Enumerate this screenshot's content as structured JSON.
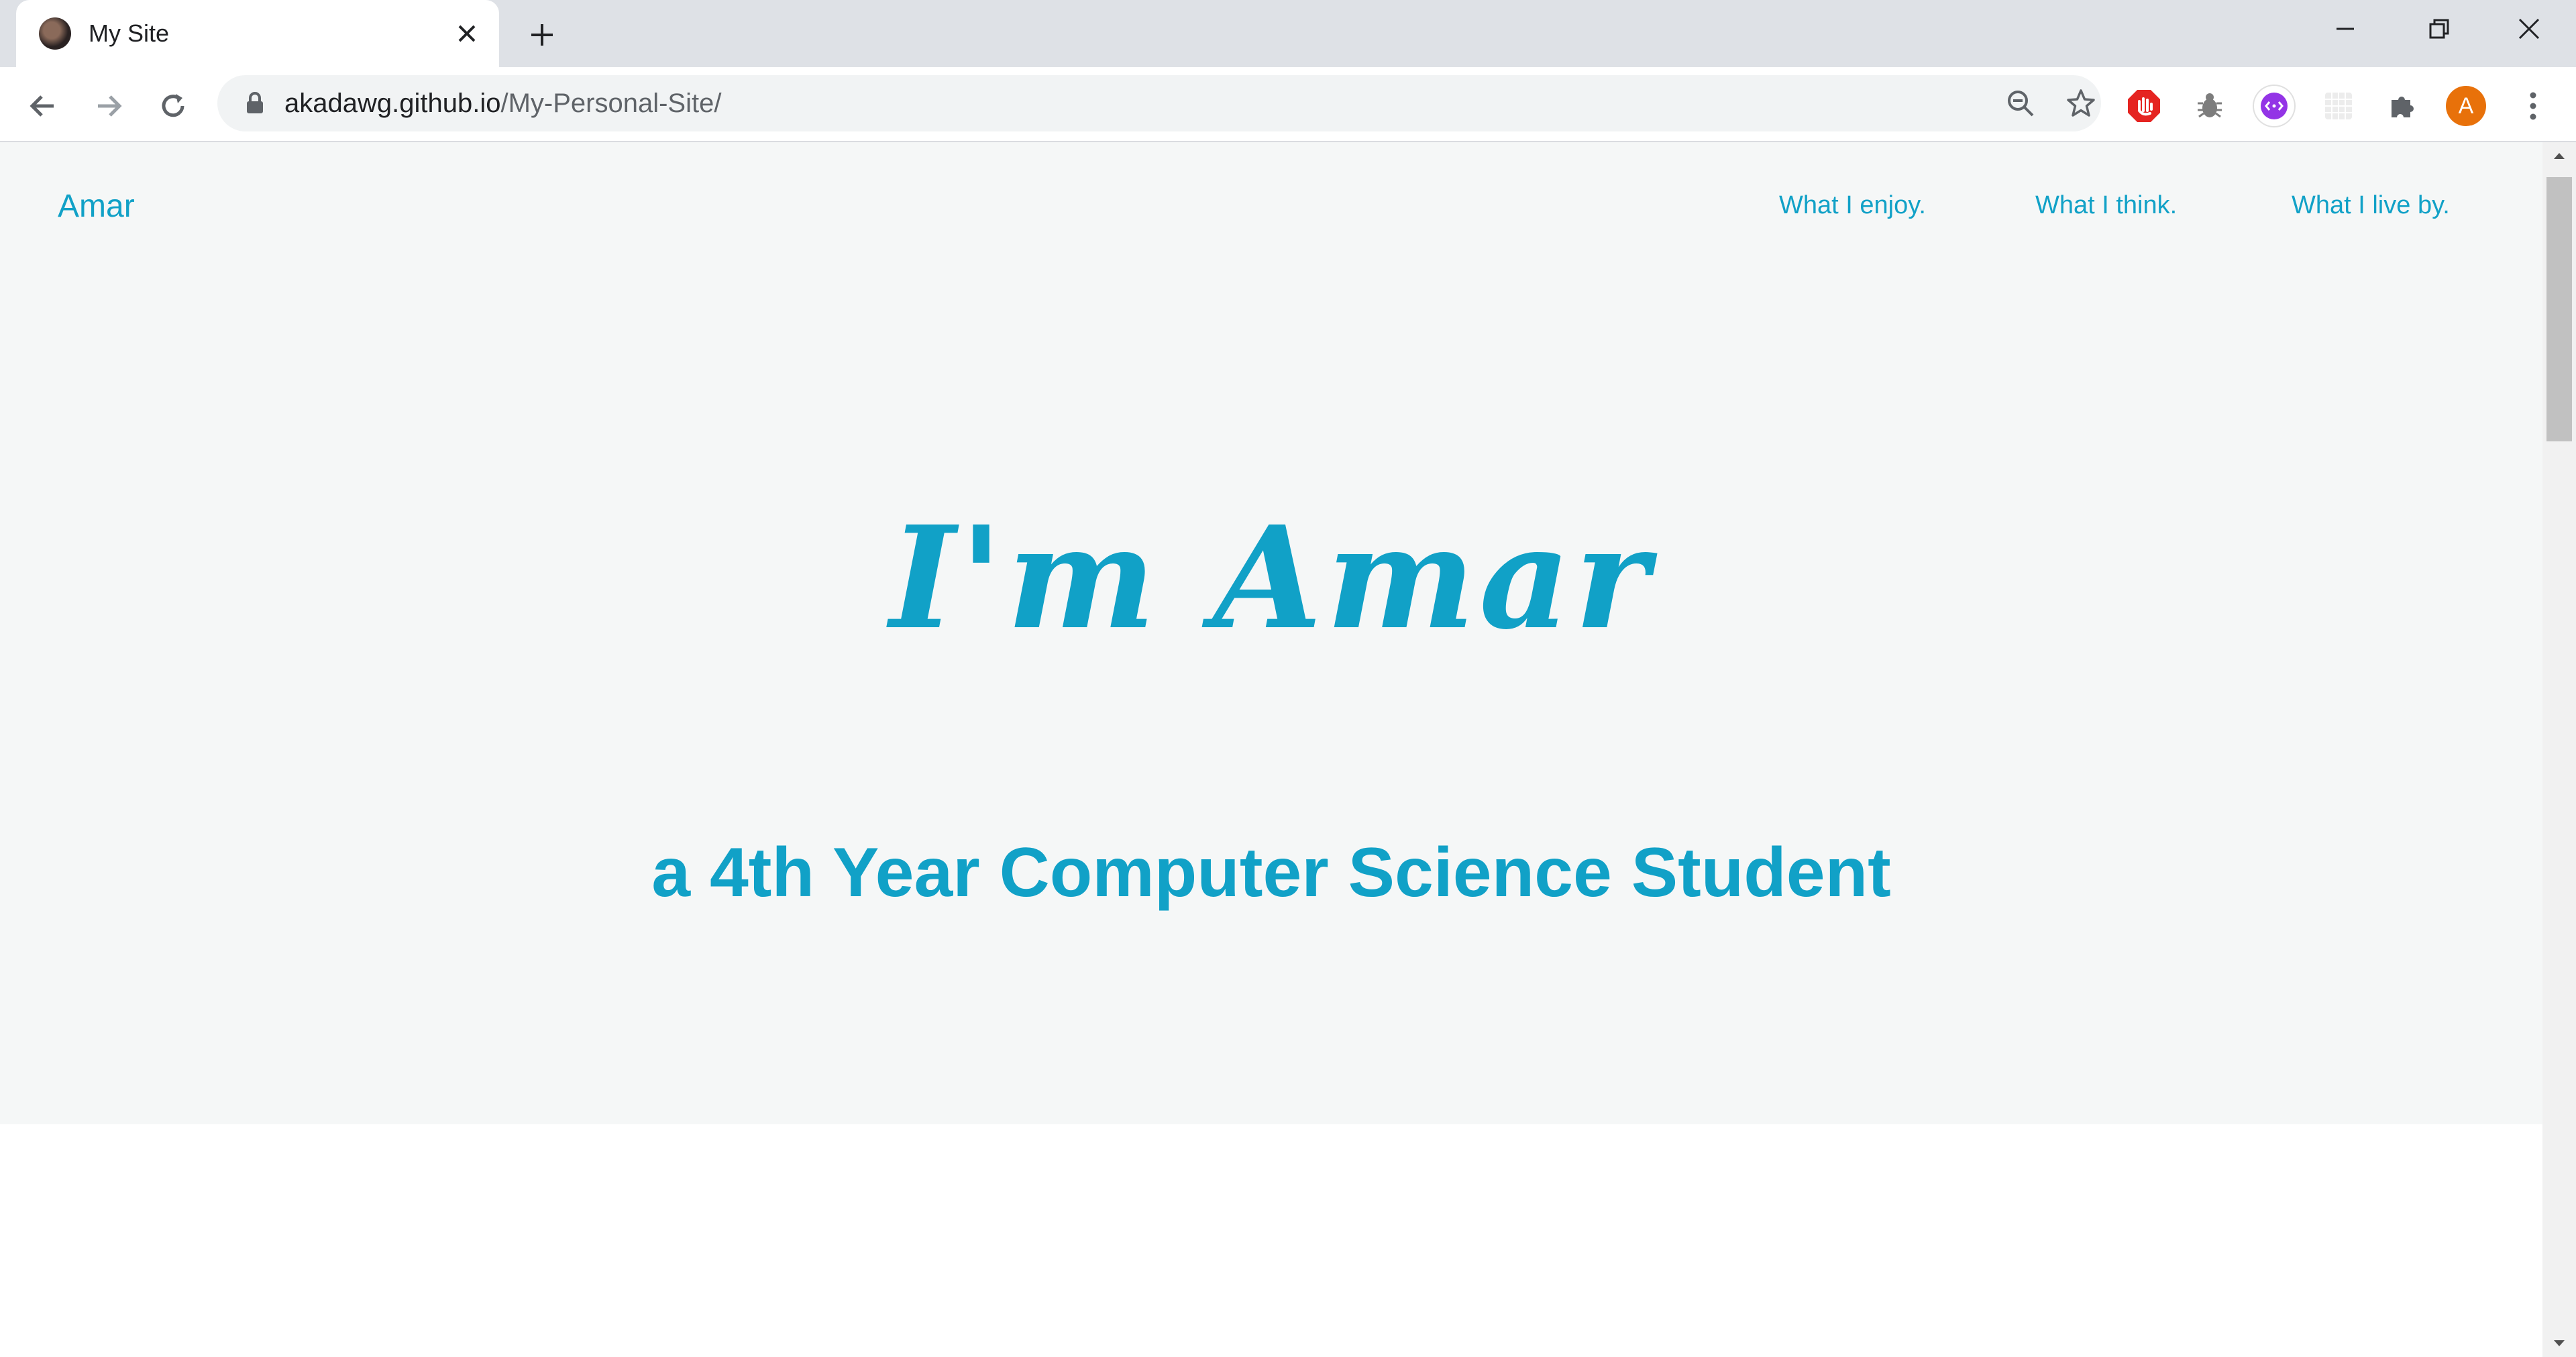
{
  "browser": {
    "tab": {
      "title": "My Site"
    },
    "url": {
      "host": "akadawg.github.io",
      "path": "/My-Personal-Site/"
    },
    "profile_initial": "A"
  },
  "site": {
    "brand": "Amar",
    "nav": [
      {
        "label": "What I enjoy."
      },
      {
        "label": "What I think."
      },
      {
        "label": "What I live by."
      }
    ],
    "hero": {
      "title": "I'm Amar",
      "subtitle": "a 4th Year Computer Science Student"
    }
  },
  "colors": {
    "accent": "#11a1c7",
    "hero_background": "#f5f7f7",
    "tabstrip": "#dee1e6"
  },
  "icons": {
    "tab_close": "close-icon",
    "new_tab": "plus-icon",
    "back": "arrow-left-icon",
    "forward": "arrow-right-icon",
    "reload": "reload-icon",
    "lock": "lock-icon",
    "zoom": "zoom-out-icon",
    "bookmark": "star-icon",
    "extensions": "puzzle-icon",
    "menu": "kebab-menu-icon"
  }
}
